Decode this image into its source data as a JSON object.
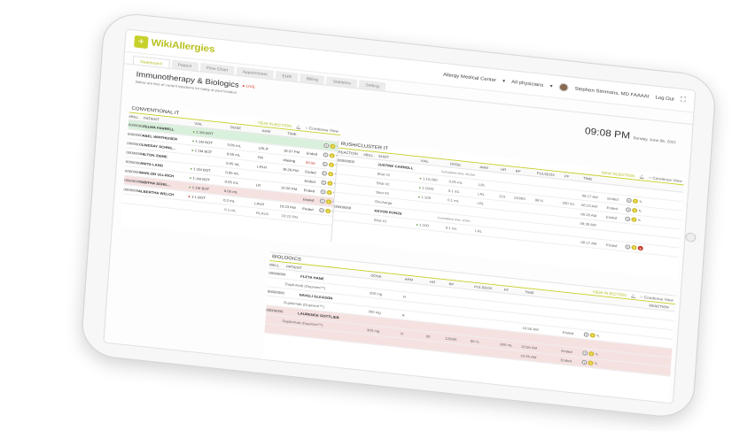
{
  "app": {
    "logo_text": "WikiAllergies",
    "location": "Allergy Medical Center",
    "physicians": "All physicians",
    "user": "Stephen Simmons, MD FAAAAI",
    "logout": "Log Out"
  },
  "tabs": [
    "Dashboard",
    "Patient",
    "Flow Chart",
    "Appointment",
    "EHR",
    "Billing",
    "Statistics",
    "Setting"
  ],
  "header": {
    "title": "Immunotherapy & Biologics",
    "live": "LIVE",
    "subtitle": "Below are lists of current injections for today at your location",
    "time": "09:08 PM",
    "date": "Sunday, June 06, 2021"
  },
  "conventional": {
    "title": "CONVENTIONAL IT",
    "new_injection": "NEW INJECTION",
    "condense": "Condense View",
    "columns": [
      "#BILL",
      "PATIENT",
      "VIAL",
      "DOSE",
      "ARM",
      "TIME"
    ],
    "rows": [
      {
        "bill": "0000000",
        "patient": "ZELMA FARRELL",
        "vial": "1:1M BOT",
        "dose": "",
        "arm": "",
        "time": ""
      },
      {
        "bill": "00000000",
        "patient": "ABEL WINTHEISER",
        "vial": "1:1M BOT",
        "dose": "0.05 mL",
        "arm": "LRLR",
        "time": "08:37 PM"
      },
      {
        "bill": "00000000",
        "patient": "LINDSAY SCHNE...",
        "vial": "1:1M BOT",
        "dose": "0.05 mL",
        "arm": "RA",
        "time": "Waiting"
      },
      {
        "bill": "00000000",
        "patient": "HILTON ZIEME",
        "vial": "",
        "dose": "0.05 mL",
        "arm": "LRLR",
        "time": "08:28 PM"
      },
      {
        "bill": "00000000",
        "patient": "ANITA LANG",
        "vial": "1:1M BOT",
        "dose": "0.05 mL",
        "arm": "",
        "time": ""
      },
      {
        "bill": "00000000",
        "patient": "MARLON ULLRICH",
        "vial": "1:1M BOT",
        "dose": "0.05 mL",
        "arm": "LR",
        "time": "10:28 PM"
      },
      {
        "bill": "00000000",
        "patient": "TABITHA SCHIL...",
        "vial": "1:1M BOT",
        "dose": "0.05 mL",
        "arm": "",
        "time": ""
      },
      {
        "bill": "00000000",
        "patient": "ALBERTHA WELCH",
        "vial": "1:1 BOT",
        "dose": "0.2 mL",
        "arm": "LRLR",
        "time": "10:23 PM"
      }
    ],
    "statuses": [
      "",
      "Ended",
      "00:56",
      "Ended",
      "Ended",
      "Ended",
      "Ended",
      "Ended"
    ],
    "extra_row": {
      "dose": "0.1 mL",
      "arm": "RLRLR",
      "time": "10:22 PM"
    }
  },
  "bush": {
    "title": "RUSH/CLUSTER IT",
    "new_injection": "NEW INJECTION",
    "condense": "Condense View",
    "columns": [
      "REACTION",
      "#BILL",
      "SHOT",
      "VIAL",
      "DOSE",
      "ARM",
      "HR",
      "BP",
      "PULSEOX",
      "PF",
      "TIME"
    ],
    "patient1": "JUSTINE CARROLL",
    "cumulative": "Cumulative time: 0h10m",
    "shots": [
      {
        "shot": "Shot #1",
        "vial": "1:10,000",
        "dose": "0.05 mL",
        "arm": "LRL",
        "time": "08:17 AM",
        "status": "Ended"
      },
      {
        "shot": "Shot #2",
        "vial": "1:1000",
        "dose": "0.1 mL",
        "arm": "LRL",
        "hr": "123",
        "bp": "120/80",
        "pulseox": "99 %",
        "pf": "300 mL",
        "time": "08:23 AM",
        "status": "Ended"
      },
      {
        "shot": "Shot #3",
        "vial": "1:100",
        "dose": "0.1 mL",
        "arm": "LRL",
        "time": "08:28 AM",
        "status": "Ended"
      },
      {
        "shot": "Discharge",
        "vial": "",
        "dose": "",
        "arm": "",
        "time": "08:38 AM",
        "status": ""
      }
    ],
    "patient2": "KEVON KUNZE",
    "cumulative2": "Cumulative time: 1h0m",
    "shot2": {
      "shot": "Shot #1",
      "vial": "1:100",
      "dose": "0.1 mL",
      "arm": "LRL",
      "time": "08:17 AM",
      "status": "Ended"
    }
  },
  "biologics": {
    "title": "BIOLOGICS",
    "new_injection": "NEW INJECTION",
    "condense": "Condense View",
    "columns": [
      "#BILL",
      "PATIENT",
      "DOSE",
      "ARM",
      "HR",
      "BP",
      "PULSEOX",
      "PF",
      "TIME",
      "REACTION"
    ],
    "rows": [
      {
        "bill": "00000000",
        "patient": "FLETA HANE",
        "drug": "Dupilumab (Dupixent™)",
        "dose": "300 mg",
        "arm": "R",
        "time": "",
        "status": ""
      },
      {
        "bill": "00000000",
        "patient": "NAVELI GLEASON",
        "drug": "Dupilumab (Dupixent™)",
        "dose": "300 mg",
        "arm": "R",
        "time": "10:56 AM",
        "status": "Ended"
      },
      {
        "bill": "00000000",
        "patient": "LAURENCE GOTTLIEB",
        "drug": "Dupilumab (Dupixent™)",
        "dose": "300 mg",
        "arm": "R",
        "hr": "80",
        "bp": "120/80",
        "pulseox": "99 %",
        "pf": "600 mL",
        "time": "10:56 AM",
        "status": "Ended"
      },
      {
        "bill": "",
        "patient": "",
        "drug": "",
        "dose": "",
        "arm": "",
        "time": "10:36 AM",
        "status": "Ended"
      }
    ]
  },
  "colors": {
    "brand": "#c8d12c",
    "green_row": "#d9f0dc",
    "pink_row": "#f6e1e1",
    "live": "#e03a2f"
  }
}
